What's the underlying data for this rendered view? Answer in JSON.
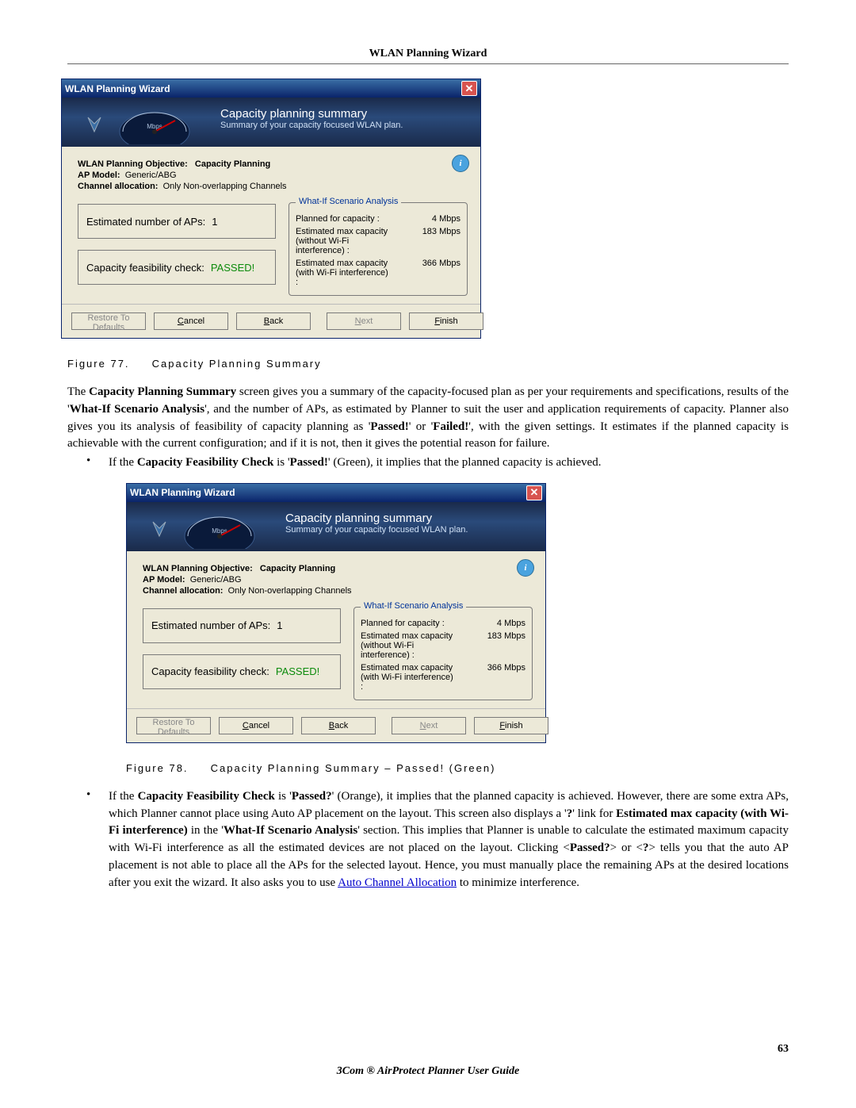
{
  "header": {
    "running_title": "WLAN Planning Wizard"
  },
  "dialog": {
    "title": "WLAN Planning Wizard",
    "banner_title": "Capacity planning summary",
    "banner_subtitle": "Summary of your capacity focused WLAN plan.",
    "gauge_unit": "Mbps",
    "specs": {
      "objective_label": "WLAN Planning Objective:",
      "objective_value": "Capacity Planning",
      "apmodel_label": "AP Model:",
      "apmodel_value": "Generic/ABG",
      "chan_label": "Channel allocation:",
      "chan_value": "Only Non-overlapping Channels"
    },
    "est_aps_label": "Estimated number of APs:",
    "est_aps_value": "1",
    "feas_label": "Capacity feasibility check:",
    "feas_value": "PASSED!",
    "whatif": {
      "legend": "What-If Scenario Analysis",
      "planned_label": "Planned for capacity :",
      "planned_value": "4 Mbps",
      "nowifi_label": "Estimated max capacity (without Wi-Fi interference) :",
      "nowifi_value": "183 Mbps",
      "wifi_label": "Estimated max capacity (with Wi-Fi interference) :",
      "wifi_value": "366 Mbps"
    },
    "buttons": {
      "restore": "Restore To Defaults",
      "cancel": "Cancel",
      "back": "Back",
      "next": "Next",
      "finish": "Finish"
    }
  },
  "fig1": {
    "num": "Figure 77.",
    "cap": "Capacity Planning Summary"
  },
  "fig2": {
    "num": "Figure 78.",
    "cap": "Capacity Planning Summary – Passed! (Green)"
  },
  "para1": {
    "a": "The ",
    "b": "Capacity Planning Summary",
    "c": " screen gives you a summary of the capacity-focused plan as per your requirements and specifications, results of the '",
    "d": "What-If Scenario Analysis",
    "e": "', and the number of APs, as estimated by Planner to suit the user and application requirements of capacity. Planner also gives you its analysis of feasibility of capacity planning as '",
    "f": "Passed!",
    "g": "' or '",
    "h": "Failed!",
    "i": "', with the given settings. It estimates if the planned capacity is achievable with the current configuration; and if it is not, then it gives the potential reason for failure."
  },
  "bullet1": {
    "a": "If the ",
    "b": "Capacity Feasibility Check",
    "c": " is '",
    "d": "Passed!",
    "e": "' (Green), it implies that the planned capacity is achieved."
  },
  "bullet2": {
    "a": "If the ",
    "b": "Capacity Feasibility Check",
    "c": " is '",
    "d": "Passed?",
    "e": "' (Orange), it implies that the planned capacity is achieved. However, there are some extra APs, which Planner cannot place using Auto AP placement on the layout. This screen also displays a '",
    "f": "?",
    "g": "' link for ",
    "h": "Estimated max capacity (with Wi-Fi interference)",
    "i": " in the '",
    "j": "What-If Scenario Analysis",
    "k": "' section. This implies that Planner is unable to calculate the estimated maximum capacity with Wi-Fi interference as all the estimated devices are not placed on the layout. Clicking <",
    "l": "Passed?",
    "m": "> or <",
    "n": "?",
    "o": "> tells you that the auto AP placement is not able to place all the APs for the selected layout. Hence, you must manually place the remaining APs at the desired locations after you exit the wizard. It also asks you to use ",
    "p": "Auto Channel Allocation",
    "q": " to minimize interference."
  },
  "pagenum": "63",
  "footer": "3Com ® AirProtect Planner User Guide"
}
